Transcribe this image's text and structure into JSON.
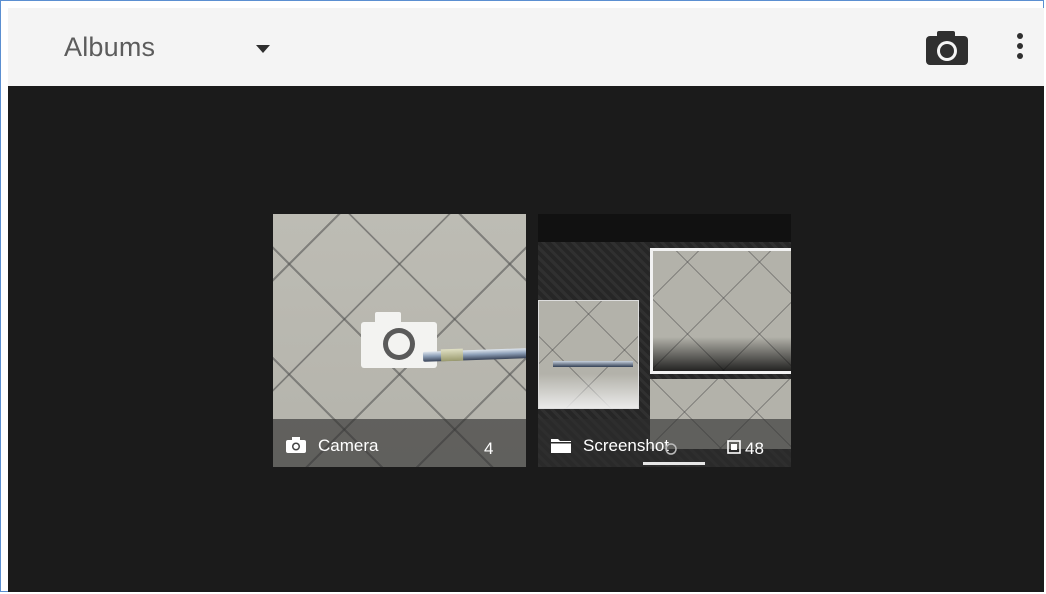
{
  "appbar": {
    "title": "Albums",
    "dropdown_icon": "caret-down-icon",
    "camera_icon": "camera-icon",
    "overflow_icon": "more-vert-icon"
  },
  "albums": [
    {
      "label": "Camera",
      "count": "4",
      "icon": "camera-icon"
    },
    {
      "label": "Screenshot",
      "count": "48",
      "icon": "folder-icon"
    }
  ],
  "colors": {
    "appbar_bg": "#f4f4f4",
    "content_bg": "#1b1b1b",
    "title_text": "#5c5c5c"
  }
}
